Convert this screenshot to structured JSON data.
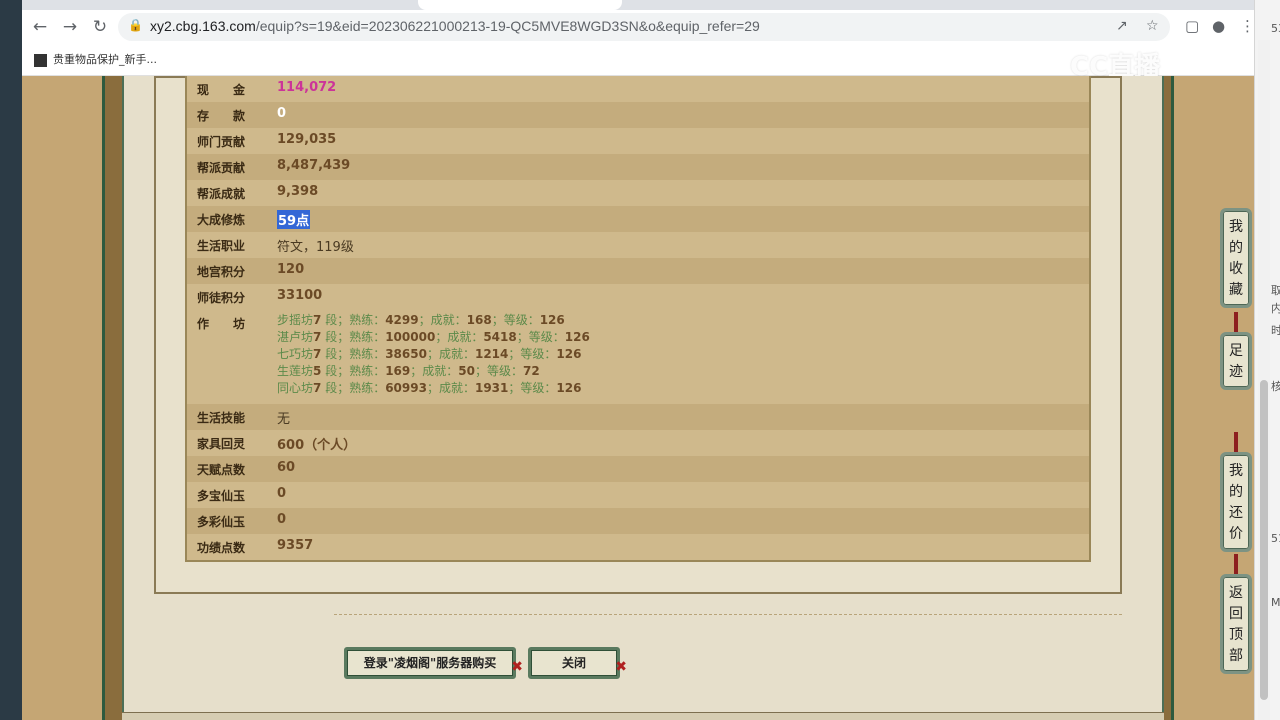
{
  "browser": {
    "url_host": "xy2.cbg.163.com",
    "url_path": "/equip?s=19&eid=202306221000213-19-QC5MVE8WGD3SN&o&equip_refer=29",
    "bookmark_label": "贵重物品保护_新手...",
    "watermark": "CC直播"
  },
  "right_edge_fragments": [
    "53",
    "取",
    "内",
    "时",
    "核",
    "51",
    "M"
  ],
  "stats": [
    {
      "label": "现　　金",
      "value": "114,072",
      "style": "pink"
    },
    {
      "label": "存　　款",
      "value": "0",
      "style": "white"
    },
    {
      "label": "师门贡献",
      "value": "129,035",
      "style": "normal"
    },
    {
      "label": "帮派贡献",
      "value": "8,487,439",
      "style": "normal"
    },
    {
      "label": "帮派成就",
      "value": "9,398",
      "style": "normal"
    },
    {
      "label": "大成修炼",
      "value": "59点",
      "style": "selected"
    },
    {
      "label": "生活职业",
      "value": "符文，119级",
      "style": "plain"
    },
    {
      "label": "地宫积分",
      "value": "120",
      "style": "normal"
    },
    {
      "label": "师徒积分",
      "value": "33100",
      "style": "normal"
    }
  ],
  "workshop": {
    "label": "作　　坊",
    "lines": [
      {
        "name": "步摇坊",
        "level": "7",
        "proficiency": "4299",
        "achievement": "168",
        "grade": "126"
      },
      {
        "name": "湛卢坊",
        "level": "7",
        "proficiency": "100000",
        "achievement": "5418",
        "grade": "126"
      },
      {
        "name": "七巧坊",
        "level": "7",
        "proficiency": "38650",
        "achievement": "1214",
        "grade": "126"
      },
      {
        "name": "生莲坊",
        "level": "5",
        "proficiency": "169",
        "achievement": "50",
        "grade": "72"
      },
      {
        "name": "同心坊",
        "level": "7",
        "proficiency": "60993",
        "achievement": "1931",
        "grade": "126"
      }
    ],
    "words": {
      "seg": " 段；熟练：",
      "ach": "；成就：",
      "grade": "；等级："
    }
  },
  "stats2": [
    {
      "label": "生活技能",
      "value": "无",
      "style": "plain"
    },
    {
      "label": "家具回灵",
      "value": "600（个人）",
      "style": "normal"
    },
    {
      "label": "天赋点数",
      "value": "60",
      "style": "normal"
    },
    {
      "label": "多宝仙玉",
      "value": "0",
      "style": "normal"
    },
    {
      "label": "多彩仙玉",
      "value": "0",
      "style": "normal"
    },
    {
      "label": "功绩点数",
      "value": "9357",
      "style": "normal"
    }
  ],
  "buttons": {
    "buy": "登录\"凌烟阁\"服务器购买",
    "close": "关闭"
  },
  "side_buttons": [
    {
      "chars": [
        "我",
        "的",
        "收",
        "藏"
      ]
    },
    {
      "chars": [
        "足",
        "迹"
      ]
    },
    {
      "chars": [
        "我",
        "的",
        "还",
        "价"
      ]
    },
    {
      "chars": [
        "返",
        "回",
        "顶",
        "部"
      ]
    }
  ]
}
